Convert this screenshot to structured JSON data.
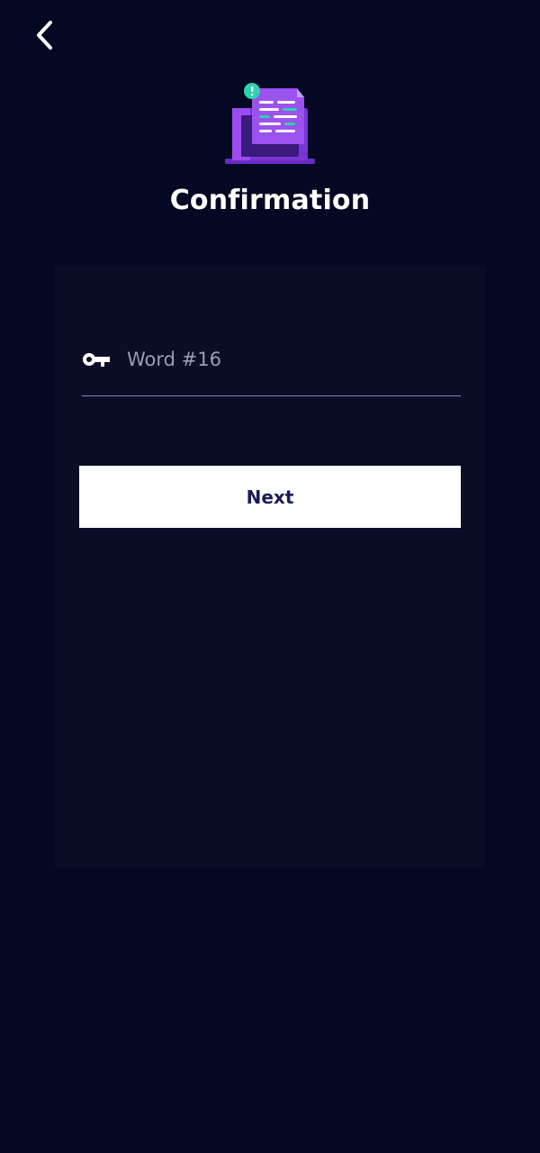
{
  "header": {
    "back_icon": "chevron-left-icon",
    "hero_icon": "laptop-document-icon",
    "title": "Confirmation"
  },
  "form": {
    "key_icon": "key-icon",
    "word_placeholder": "Word #16",
    "word_value": "",
    "next_label": "Next"
  },
  "colors": {
    "background": "#050822",
    "card": "#0a0d26",
    "button_bg": "#ffffff",
    "button_text": "#1a1d55",
    "accent_purple": "#8a3ee0",
    "accent_teal": "#2fd1b0"
  }
}
